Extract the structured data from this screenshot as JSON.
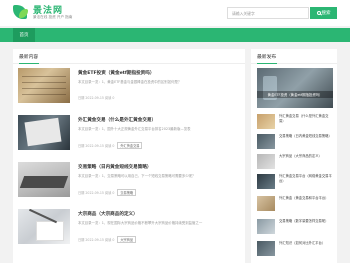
{
  "header": {
    "site_title": "景法网",
    "site_subtitle": "景法在线 投资 开户 指南",
    "search_placeholder": "请输入关键字",
    "search_button": "搜索"
  },
  "nav": {
    "home": "首页"
  },
  "main": {
    "section_title": "最新内容",
    "articles": [
      {
        "title": "黄金ETF投资（黄金etf期指投资吗）",
        "desc": "本文目录一览：1、黄金ETF基金与金银棒金在投资中的区别如何是？",
        "date": "日期 2022-09-15 阅读 0",
        "tag": ""
      },
      {
        "title": "外汇黄金交易（什么是外汇黄金交易）",
        "desc": "本文目录一览：1、国外十大正规黄金外汇交易平台排名2023最新版—览表",
        "date": "日期 2022-09-15 阅读 0",
        "tag": "外汇黄金交易"
      },
      {
        "title": "交易策略（日内黄金短线交易策略）",
        "desc": "本文目录一览：1、交易策略可以用自己，下一个短线交易策略可需要多少呢？",
        "date": "日期 2022-09-15 阅读 0",
        "tag": "交易策略"
      },
      {
        "title": "大宗商品（大宗商品的定义）",
        "desc": "本文目录一览：1、现在国际大宗商品价格不断攀升大宗商品价格持续受到监管之一",
        "date": "日期 2022-09-15 阅读 0",
        "tag": "大宗商品"
      }
    ]
  },
  "side": {
    "section_title": "最新发布",
    "feature_caption": "黄金ETF投资（黄金etf期指投资吗）",
    "items": [
      "外汇黄金交易（什么是外汇黄金交易）",
      "交易策略（日内黄金短线交易策略）",
      "大宗商品（大宗商品的定义）",
      "外汇黄金交易平台（网络黄金交易平台）",
      "外汇黄金（黄金交易和平台平台）",
      "交易策略（数字量要怎样交易呢）",
      "外汇知识（如何对比外汇平台）"
    ]
  },
  "colors": {
    "brand": "#2bb673"
  }
}
